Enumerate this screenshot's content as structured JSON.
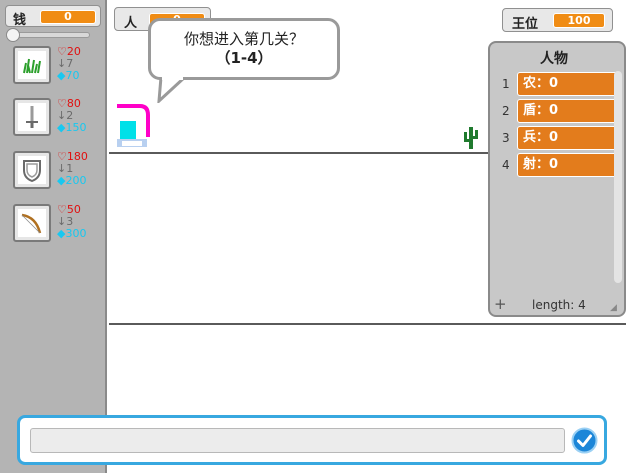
{
  "sidebar": {
    "money": {
      "label": "钱",
      "value": "0"
    },
    "slider": {
      "level": 0
    },
    "units": [
      {
        "icon": "grass-icon",
        "hp": "♡20",
        "count": "↓7",
        "cost": "◆70"
      },
      {
        "icon": "sword-icon",
        "hp": "♡80",
        "count": "↓2",
        "cost": "◆150"
      },
      {
        "icon": "shield-icon",
        "hp": "♡180",
        "count": "↓1",
        "cost": "◆200"
      },
      {
        "icon": "bow-icon",
        "hp": "♡50",
        "count": "↓3",
        "cost": "◆300"
      }
    ]
  },
  "stage": {
    "person": {
      "label": "人",
      "value": "0"
    },
    "speech": {
      "line1": "你想进入第几关？",
      "line2": "（1-4）"
    },
    "king": {
      "label": "王位",
      "value": "100"
    }
  },
  "list": {
    "title": "人物",
    "items": [
      {
        "index": "1",
        "value": "农：0"
      },
      {
        "index": "2",
        "value": "盾：0"
      },
      {
        "index": "3",
        "value": "兵：0"
      },
      {
        "index": "4",
        "value": "射：0"
      }
    ],
    "add_symbol": "+",
    "length_text": "length: 4"
  },
  "ask": {
    "value": "",
    "submit_icon": "check-icon"
  },
  "colors": {
    "accent": "#f08c14",
    "list_cell": "#e37c1c",
    "ask_border": "#38a8e0",
    "hp": "#e01010",
    "cost": "#18c8f0"
  }
}
